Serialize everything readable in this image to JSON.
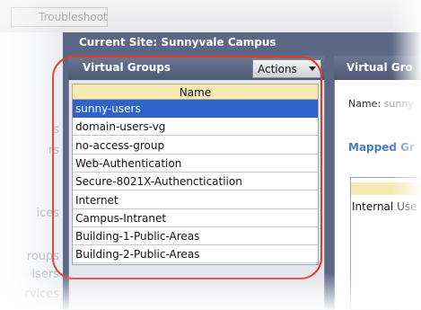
{
  "toolbar": {
    "troubleshoot_label": "Troubleshoot"
  },
  "sidebar": {
    "items": [
      {
        "label": "s"
      },
      {
        "label": "rs"
      },
      {
        "label": "ices"
      },
      {
        "label": "roups"
      },
      {
        "label": "Isers"
      },
      {
        "label": "rvices"
      }
    ]
  },
  "site": {
    "current_label": "Current Site:",
    "current_value": "Sunnyvale Campus"
  },
  "virtual_groups": {
    "title": "Virtual Groups",
    "actions_label": "Actions",
    "column_header": "Name",
    "selected_index": 0,
    "rows": [
      "sunny-users",
      "domain-users-vg",
      "no-access-group",
      "Web-Authentication",
      "Secure-8021X-Authencticatiion",
      "Internet",
      "Campus-Intranet",
      "Building-1-Public-Areas",
      "Building-2-Public-Areas"
    ]
  },
  "detail": {
    "title": "Virtual Gro",
    "name_label": "Name:",
    "name_value": "sunny",
    "mapped_label": "Mapped Gr",
    "inner_cell": "Internal Use"
  },
  "colors": {
    "frame": "#5b6784",
    "selected_row": "#2f63cc",
    "column_header": "#f7e9b4",
    "highlight": "#e23a2c",
    "mapped_link": "#4a78c8"
  }
}
